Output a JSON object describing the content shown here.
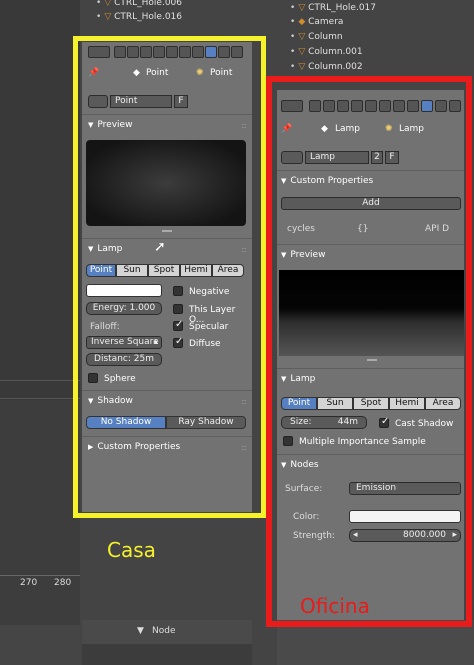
{
  "outliner_left": {
    "rows": [
      "CTRL_Hole.006",
      "CTRL_Hole.016"
    ]
  },
  "outliner_right": {
    "rows": [
      "CTRL_Hole.017",
      "Camera",
      "Column",
      "Column.001",
      "Column.002"
    ]
  },
  "timeline": {
    "ticks": [
      "270",
      "280"
    ]
  },
  "footer": {
    "node_label": "Node"
  },
  "casa": {
    "breadcrumb": {
      "obj": "Point",
      "data": "Point"
    },
    "datablock": {
      "name": "Point",
      "fake_user": "F"
    },
    "preview_title": "Preview",
    "lamp_title": "Lamp",
    "types": [
      "Point",
      "Sun",
      "Spot",
      "Hemi",
      "Area"
    ],
    "negative": "Negative",
    "energy": "Energy: 1.000",
    "this_layer": "This Layer O...",
    "falloff_label": "Falloff:",
    "specular": "Specular",
    "falloff_value": "Inverse Square",
    "diffuse": "Diffuse",
    "distance": "Distanc: 25m",
    "sphere": "Sphere",
    "shadow_title": "Shadow",
    "no_shadow": "No Shadow",
    "ray_shadow": "Ray Shadow",
    "custom_props": "Custom Properties"
  },
  "oficina": {
    "breadcrumb": {
      "obj": "Lamp",
      "data": "Lamp"
    },
    "datablock": {
      "name": "Lamp",
      "users": "2",
      "fake_user": "F"
    },
    "custom_props": "Custom Properties",
    "add": "Add",
    "cycles": "cycles",
    "braces": "{}",
    "api": "API D",
    "preview_title": "Preview",
    "lamp_title": "Lamp",
    "types": [
      "Point",
      "Sun",
      "Spot",
      "Hemi",
      "Area"
    ],
    "size": "Size:",
    "size_value": "44m",
    "cast_shadow": "Cast Shadow",
    "mis": "Multiple Importance Sample",
    "nodes_title": "Nodes",
    "surface_label": "Surface:",
    "surface_value": "Emission",
    "color_label": "Color:",
    "strength_label": "Strength:",
    "strength_value": "8000.000"
  },
  "captions": {
    "casa": "Casa",
    "oficina": "Oficina"
  },
  "colors": {
    "highlight_yellow": "#f5f22c",
    "highlight_red": "#e91b1b",
    "active_blue": "#5680c2"
  }
}
